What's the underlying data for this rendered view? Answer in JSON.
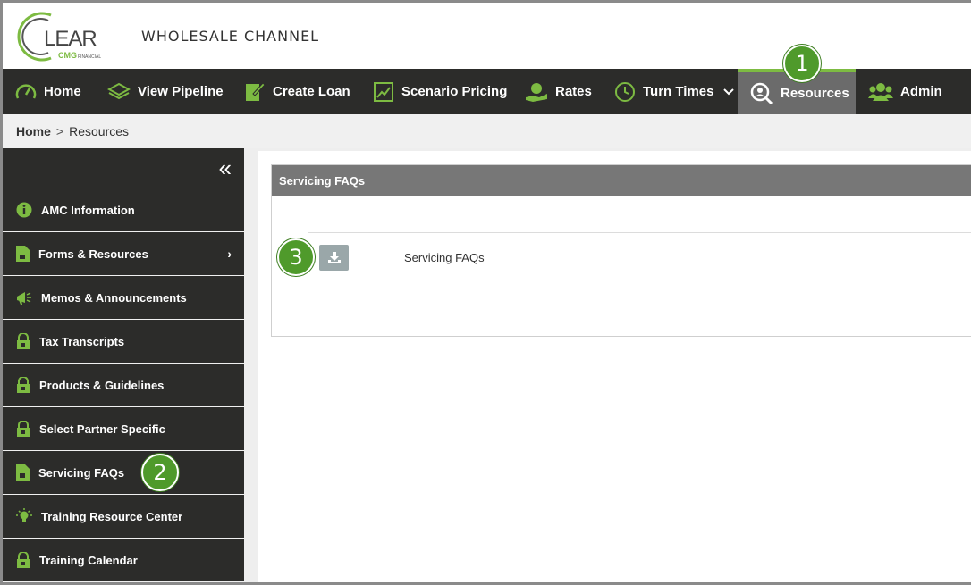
{
  "header": {
    "logo_text": "CLEAR",
    "logo_sub": "by CMG FINANCIAL",
    "channel": "WHOLESALE CHANNEL"
  },
  "nav": {
    "items": [
      {
        "label": "Home",
        "icon": "speedometer-icon"
      },
      {
        "label": "View Pipeline",
        "icon": "layers-icon"
      },
      {
        "label": "Create Loan",
        "icon": "edit-document-icon"
      },
      {
        "label": "Scenario Pricing",
        "icon": "chart-icon"
      },
      {
        "label": "Rates",
        "icon": "money-hand-icon"
      },
      {
        "label": "Turn Times",
        "icon": "clock-icon"
      },
      {
        "label": "Resources",
        "icon": "user-search-icon"
      },
      {
        "label": "Admin",
        "icon": "users-icon"
      }
    ],
    "active": "Resources"
  },
  "breadcrumb": {
    "home": "Home",
    "separator": ">",
    "current": "Resources"
  },
  "sidebar": {
    "collapse_icon": "«",
    "items": [
      {
        "label": "AMC Information",
        "icon": "info-icon"
      },
      {
        "label": "Forms & Resources",
        "icon": "document-icon"
      },
      {
        "label": "Memos & Announcements",
        "icon": "megaphone-icon"
      },
      {
        "label": "Tax Transcripts",
        "icon": "lock-icon"
      },
      {
        "label": "Products & Guidelines",
        "icon": "lock-icon"
      },
      {
        "label": "Select Partner Specific",
        "icon": "lock-icon"
      },
      {
        "label": "Servicing FAQs",
        "icon": "document-icon"
      },
      {
        "label": "Training Resource Center",
        "icon": "lightbulb-icon"
      },
      {
        "label": "Training Calendar",
        "icon": "lock-icon"
      }
    ]
  },
  "panel": {
    "title": "Servicing FAQs",
    "file_label": "Servicing FAQs"
  },
  "callouts": [
    "1",
    "2",
    "3"
  ],
  "colors": {
    "accent": "#7dbb42",
    "nav_bg": "#2c2c2a",
    "active_bg": "#6b6b6b",
    "callout": "#4f9a2b"
  }
}
